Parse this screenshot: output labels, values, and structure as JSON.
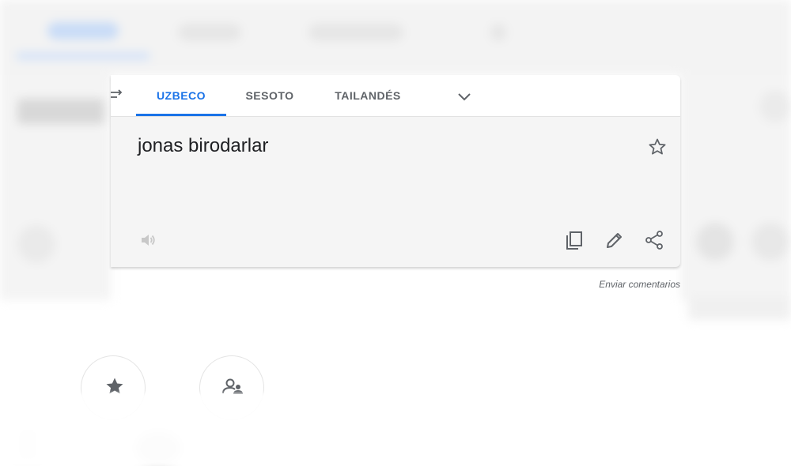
{
  "language_tabs": {
    "tabs": [
      {
        "label": "UZBECO",
        "active": true
      },
      {
        "label": "SESOTO",
        "active": false
      },
      {
        "label": "TAILANDÉS",
        "active": false
      }
    ],
    "more_icon": "chevron-down-icon",
    "swap_icon": "swap-languages-icon"
  },
  "result": {
    "text": "jonas birodarlar"
  },
  "actions": {
    "star_icon": "star-outline-icon",
    "speaker_icon": "speaker-icon",
    "copy_icon": "copy-icon",
    "edit_icon": "edit-pencil-icon",
    "share_icon": "share-icon"
  },
  "feedback_link": "Enviar comentarios",
  "colors": {
    "accent": "#1a73e8",
    "tab_text": "#5f6368",
    "panel_bg": "#f5f5f5",
    "text": "#202124"
  }
}
